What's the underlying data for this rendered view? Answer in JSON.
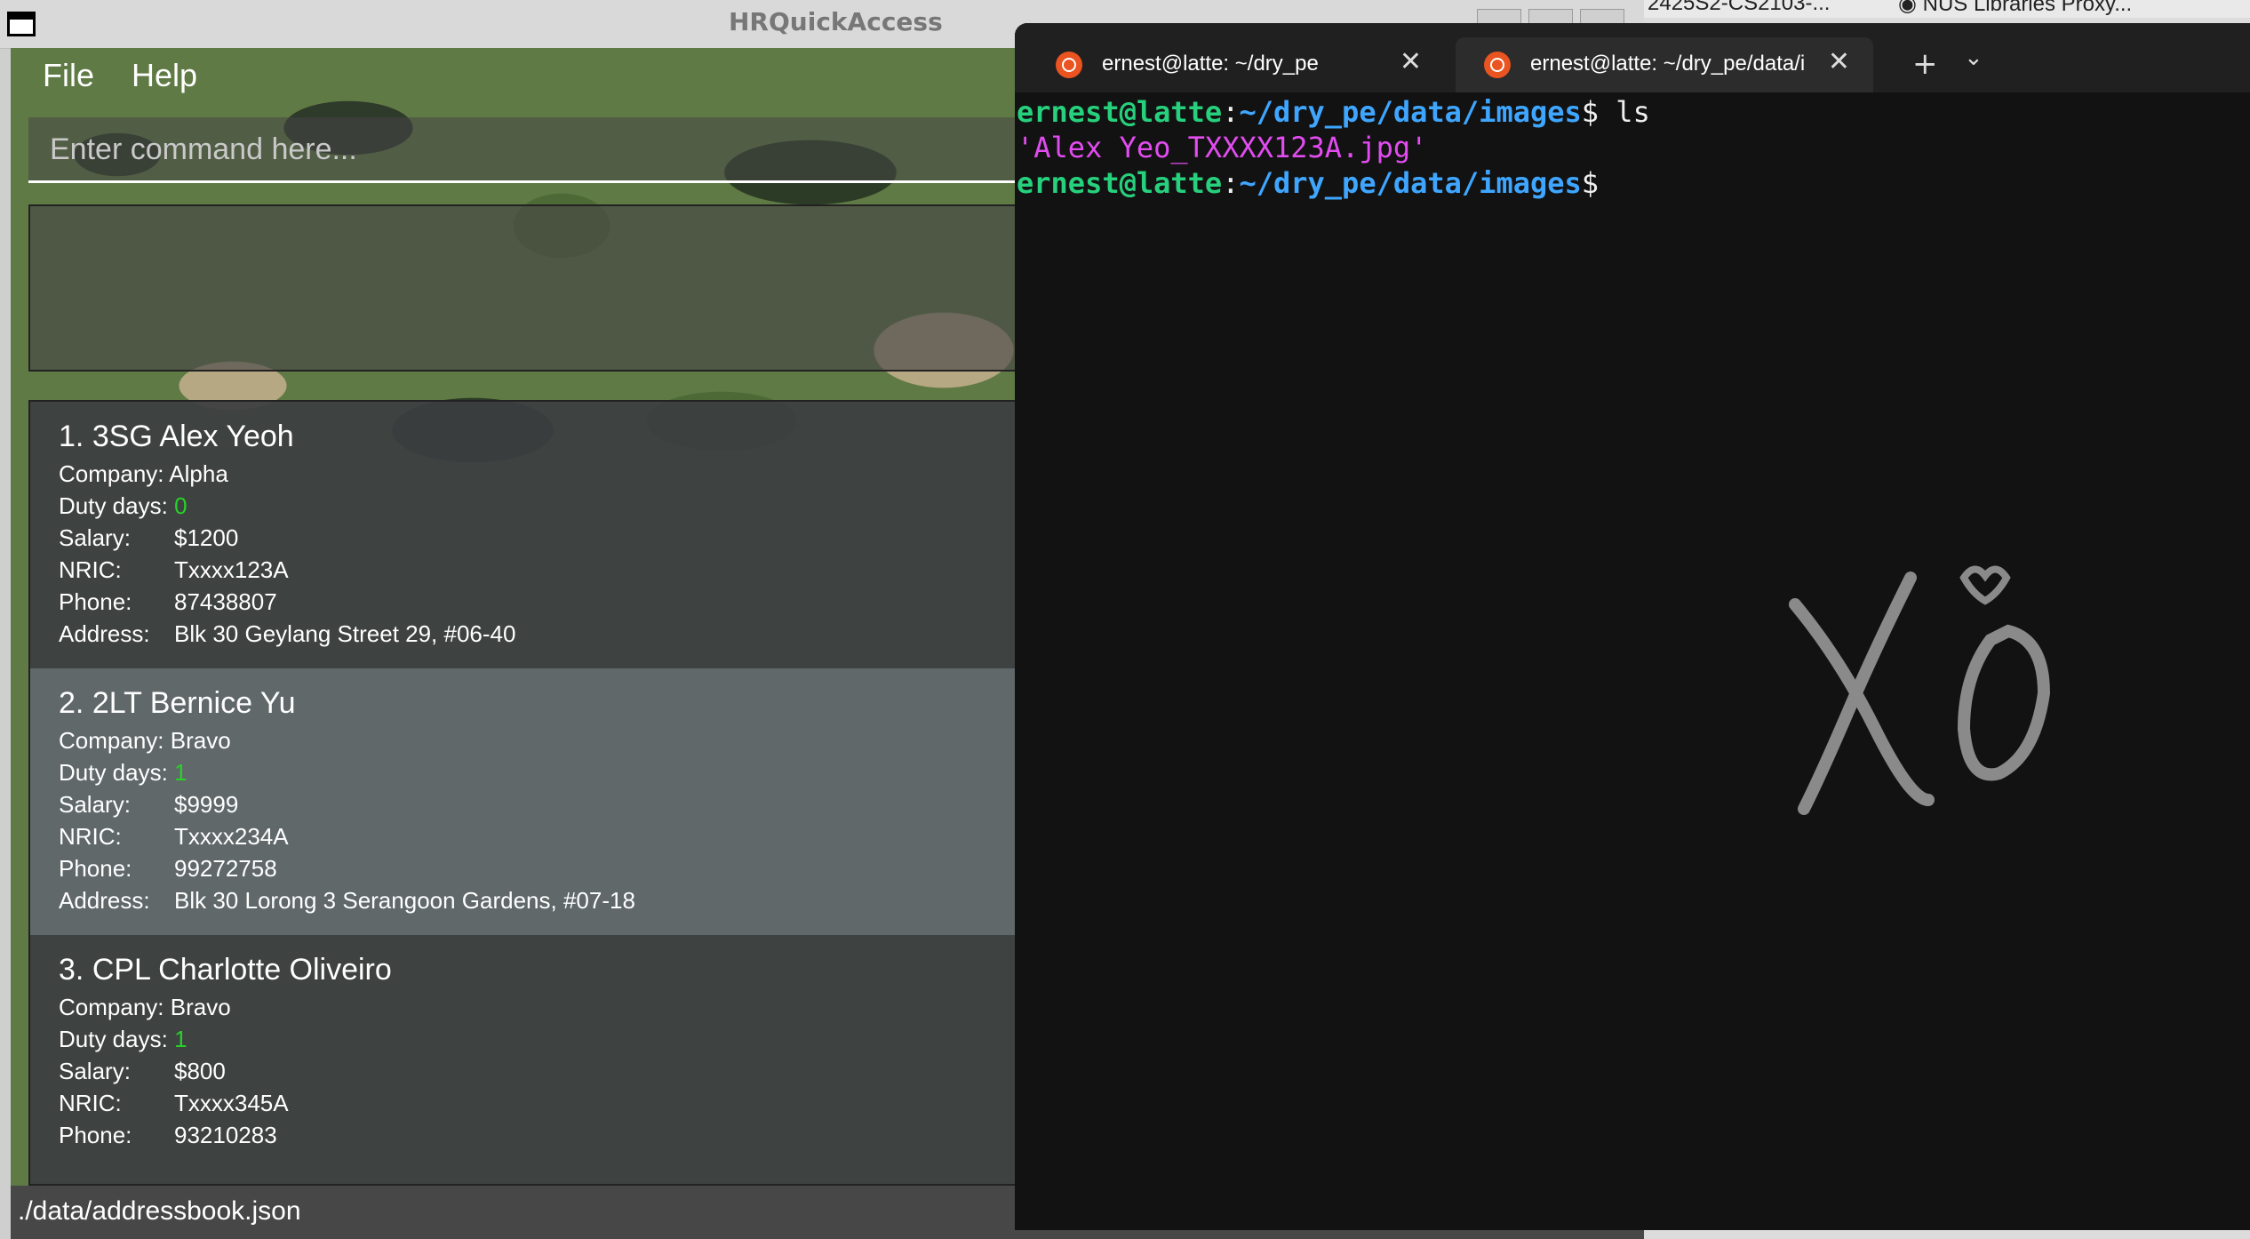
{
  "hr_app": {
    "title": "HRQuickAccess",
    "menu": [
      "File",
      "Help"
    ],
    "command_placeholder": "Enter command here...",
    "result_text": "",
    "people": [
      {
        "index": "1.",
        "name": "3SG Alex Yeoh",
        "company": "Alpha",
        "duty_days": "0",
        "salary": "$1200",
        "nric": "Txxxx123A",
        "phone": "87438807",
        "address": "Blk 30 Geylang Street 29, #06-40"
      },
      {
        "index": "2.",
        "name": "2LT Bernice Yu",
        "company": "Bravo",
        "duty_days": "1",
        "salary": "$9999",
        "nric": "Txxxx234A",
        "phone": "99272758",
        "address": "Blk 30 Lorong 3 Serangoon Gardens, #07-18"
      },
      {
        "index": "3.",
        "name": "CPL Charlotte Oliveiro",
        "company": "Bravo",
        "duty_days": "1",
        "salary": "$800",
        "nric": "Txxxx345A",
        "phone": "93210283",
        "address": ""
      }
    ],
    "labels": {
      "company": "Company:",
      "duty_days": "Duty days:",
      "salary": "Salary:",
      "nric": "NRIC:",
      "phone": "Phone:",
      "address": "Address:"
    },
    "status_bar": "./data/addressbook.json"
  },
  "terminal": {
    "tabs": [
      {
        "title": "ernest@latte: ~/dry_pe",
        "active": false
      },
      {
        "title": "ernest@latte: ~/dry_pe/data/i",
        "active": true
      }
    ],
    "lines": [
      {
        "user": "ernest@latte",
        "path": "~/dry_pe/data/images",
        "cmd": "ls"
      },
      {
        "output": "'Alex Yeo_TXXXX123A.jpg'"
      },
      {
        "user": "ernest@latte",
        "path": "~/dry_pe/data/images",
        "cmd": ""
      }
    ],
    "watermark": "XO"
  },
  "browser_tabs": [
    "2425S2-CS2103-...",
    "NUS Libraries Proxy..."
  ],
  "colors": {
    "green_value": "#27d227",
    "term_user": "#26d07c",
    "term_path": "#3fa6ff",
    "term_file": "#e24cf0",
    "ubuntu_orange": "#e95420"
  }
}
